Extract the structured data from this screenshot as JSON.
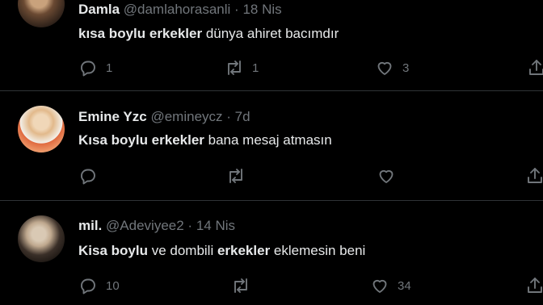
{
  "tweets": [
    {
      "name": "Damla",
      "handle": "@damlahorasanli",
      "separator": "·",
      "time": "18 Nis",
      "text_parts": [
        {
          "text": "kısa boylu erkekler",
          "bold": true
        },
        {
          "text": " dünya ahiret bacımdır",
          "bold": false
        }
      ],
      "replies": "1",
      "retweets": "1",
      "likes": "3"
    },
    {
      "name": "Emine Yzc",
      "handle": "@emineycz",
      "separator": "·",
      "time": "7d",
      "text_parts": [
        {
          "text": "Kısa boylu erkekler",
          "bold": true
        },
        {
          "text": " bana mesaj atmasın",
          "bold": false
        }
      ],
      "replies": "",
      "retweets": "",
      "likes": ""
    },
    {
      "name": "mil.",
      "handle": "@Adeviyee2",
      "separator": "·",
      "time": "14 Nis",
      "text_parts": [
        {
          "text": "Kisa boylu",
          "bold": true
        },
        {
          "text": " ve dombili ",
          "bold": false
        },
        {
          "text": "erkekler",
          "bold": true
        },
        {
          "text": " eklemesin beni",
          "bold": false
        }
      ],
      "replies": "10",
      "retweets": "",
      "likes": "34"
    }
  ],
  "icons": {
    "reply": "reply-icon",
    "retweet": "retweet-icon",
    "like": "heart-icon",
    "share": "share-icon"
  },
  "colors": {
    "background": "#000000",
    "text": "#e7e9ea",
    "secondary": "#71767b",
    "divider": "#2f3336"
  }
}
